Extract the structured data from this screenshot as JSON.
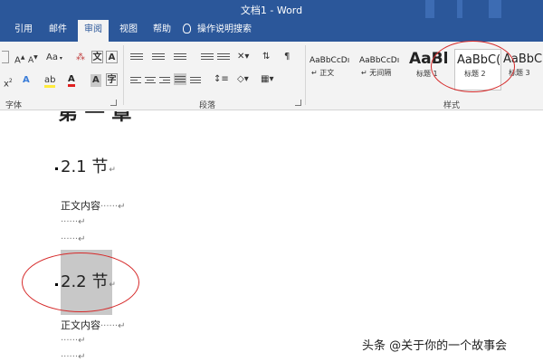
{
  "window": {
    "title": "文档1 - Word"
  },
  "tabs": [
    "引用",
    "邮件",
    "审阅",
    "视图",
    "帮助"
  ],
  "active_tab": "审阅",
  "tell_me": "操作说明搜索",
  "ribbon": {
    "groups": {
      "font": "字体",
      "paragraph": "段落",
      "styles": "样式"
    },
    "font_buttons": {
      "grow": "A",
      "shrink": "A",
      "case": "Aa",
      "effects": "A",
      "highlight": "ab",
      "font_color": "A",
      "shade": "A",
      "subscript": "x",
      "char_border": "A"
    },
    "styles_gallery": [
      {
        "preview": "AaBbCcDı",
        "label": "↵ 正文"
      },
      {
        "preview": "AaBbCcDı",
        "label": "↵ 无间隔"
      },
      {
        "preview": "AaBl",
        "label": "标题 1"
      },
      {
        "preview": "AaBbC(",
        "label": "标题 2",
        "selected": true
      },
      {
        "preview": "AaBbC",
        "label": "标题 3"
      }
    ]
  },
  "document": {
    "partial_heading": "第 一 章",
    "section1": {
      "heading": "2.1 节",
      "para_mark": "↵",
      "body": "正文内容",
      "trail": "······↵",
      "dots1": "······↵",
      "dots2": "······↵"
    },
    "section2": {
      "heading": "2.2 节",
      "para_mark": "↵",
      "body": "正文内容",
      "trail": "······↵",
      "dots1": "······↵",
      "dots2": "······↵"
    }
  },
  "watermark": "头条 @关于你的一个故事会",
  "colors": {
    "ribbon_blue": "#2b579a",
    "annotation_red": "#d62a2a"
  }
}
